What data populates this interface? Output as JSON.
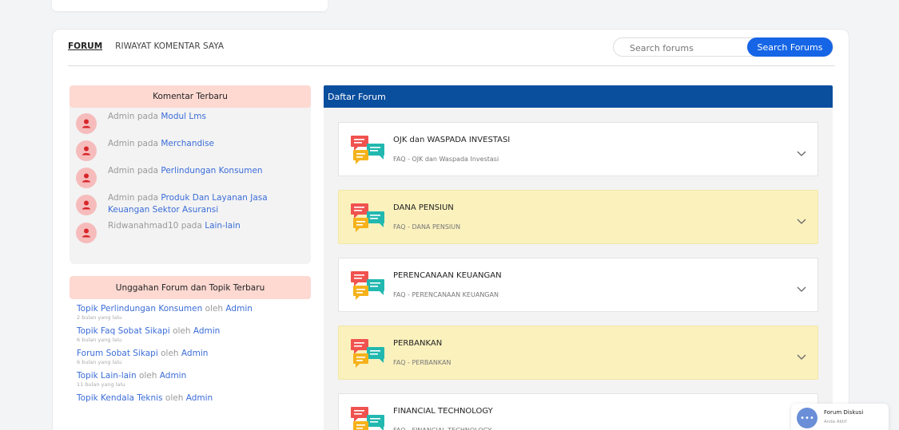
{
  "nav": {
    "tab_forum": "FORUM",
    "tab_history": "RIWAYAT KOMENTAR SAYA"
  },
  "search": {
    "placeholder": "Search forums",
    "button_label": "Search Forums"
  },
  "recent_comments": {
    "title": "Komentar Terbaru",
    "items": [
      {
        "user": "Admin",
        "connector": "pada",
        "topic": "Modul Lms"
      },
      {
        "user": "Admin",
        "connector": "pada",
        "topic": "Merchandise"
      },
      {
        "user": "Admin",
        "connector": "pada",
        "topic": "Perlindungan Konsumen"
      },
      {
        "user": "Admin",
        "connector": "pada",
        "topic": "Produk Dan Layanan Jasa Keuangan Sektor Asuransi"
      },
      {
        "user": "Ridwanahmad10",
        "connector": "pada",
        "topic": "Lain-lain"
      }
    ]
  },
  "recent_uploads": {
    "title": "Unggahan Forum dan Topik Terbaru",
    "items": [
      {
        "label": "Topik Perlindungan Konsumen",
        "by": "oleh",
        "author": "Admin",
        "ago": "2 bulan yang lalu"
      },
      {
        "label": "Topik Faq Sobat Sikapi",
        "by": "oleh",
        "author": "Admin",
        "ago": "6 bulan yang lalu"
      },
      {
        "label": "Forum Sobat Sikapi",
        "by": "oleh",
        "author": "Admin",
        "ago": "6 bulan yang lalu"
      },
      {
        "label": "Topik Lain-lain",
        "by": "oleh",
        "author": "Admin",
        "ago": "11 bulan yang lalu"
      },
      {
        "label": "Topik Kendala Teknis",
        "by": "oleh",
        "author": "Admin",
        "ago": ""
      }
    ]
  },
  "forum_list": {
    "title": "Daftar Forum",
    "items": [
      {
        "title": "OJK dan WASPADA INVESTASI",
        "subtitle": "FAQ - OJK dan Waspada Investasi",
        "highlighted": false
      },
      {
        "title": "DANA PENSIUN",
        "subtitle": "FAQ - DANA PENSIUN",
        "highlighted": true
      },
      {
        "title": "PERENCANAAN KEUANGAN",
        "subtitle": "FAQ - PERENCANAAN KEUANGAN",
        "highlighted": false
      },
      {
        "title": "PERBANKAN",
        "subtitle": "FAQ - PERBANKAN",
        "highlighted": true
      },
      {
        "title": "FINANCIAL TECHNOLOGY",
        "subtitle": "FAQ - FINANCIAL TECHNOLOGY",
        "highlighted": false
      }
    ]
  },
  "chat_widget": {
    "title": "Forum Diskusi",
    "status": "Anda Aktif"
  },
  "colors": {
    "accent_blue": "#1565e6",
    "header_navy": "#0a4e9e",
    "panel_pink": "#fdd9d2",
    "highlight_yellow": "#fbf1bd",
    "link_blue": "#3b6dd8"
  }
}
